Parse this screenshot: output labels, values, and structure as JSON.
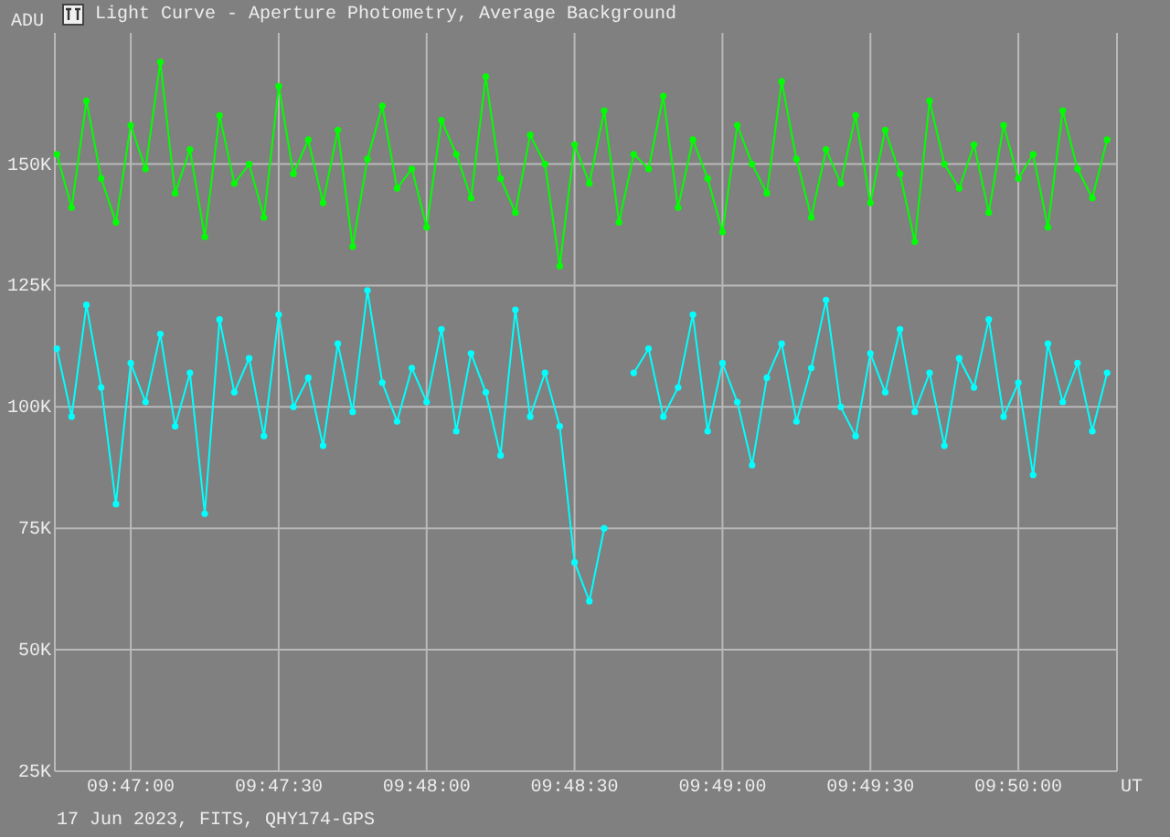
{
  "window": {
    "title": "Light Curve - Aperture Photometry, Average Background"
  },
  "chart": {
    "chart_data": {
      "type": "line",
      "grid": true,
      "xlabel": "UT",
      "ylabel": "ADU",
      "categories": [
        null,
        null,
        null,
        null,
        null,
        "09:47:00",
        null,
        null,
        null,
        null,
        null,
        null,
        null,
        null,
        null,
        "09:47:30",
        null,
        null,
        null,
        null,
        null,
        null,
        null,
        null,
        null,
        "09:48:00",
        null,
        null,
        null,
        null,
        null,
        null,
        null,
        null,
        null,
        "09:48:30",
        null,
        null,
        null,
        null,
        null,
        null,
        null,
        null,
        null,
        "09:49:00",
        null,
        null,
        null,
        null,
        null,
        null,
        null,
        null,
        null,
        "09:49:30",
        null,
        null,
        null,
        null,
        null,
        null,
        null,
        null,
        null,
        "09:50:00",
        null,
        null,
        null,
        null,
        null,
        null
      ],
      "series": [
        {
          "color": "#00ff00",
          "marker": "circle",
          "values": [
            152000,
            141000,
            163000,
            147000,
            138000,
            158000,
            149000,
            171000,
            144000,
            153000,
            135000,
            160000,
            146000,
            150000,
            139000,
            166000,
            148000,
            155000,
            142000,
            157000,
            133000,
            151000,
            162000,
            145000,
            149000,
            137000,
            159000,
            152000,
            143000,
            168000,
            147000,
            140000,
            156000,
            150000,
            129000,
            154000,
            146000,
            161000,
            138000,
            152000,
            149000,
            164000,
            141000,
            155000,
            147000,
            136000,
            158000,
            150000,
            144000,
            167000,
            151000,
            139000,
            153000,
            146000,
            160000,
            142000,
            157000,
            148000,
            134000,
            163000,
            150000,
            145000,
            154000,
            140000,
            158000,
            147000,
            152000,
            137000,
            161000,
            149000,
            143000,
            155000
          ]
        },
        {
          "color": "#00ffff",
          "marker": "circle",
          "values": [
            112000,
            98000,
            121000,
            104000,
            80000,
            109000,
            101000,
            115000,
            96000,
            107000,
            78000,
            118000,
            103000,
            110000,
            94000,
            119000,
            100000,
            106000,
            92000,
            113000,
            99000,
            124000,
            105000,
            97000,
            108000,
            101000,
            116000,
            95000,
            111000,
            103000,
            90000,
            120000,
            98000,
            107000,
            96000,
            68000,
            60000,
            75000,
            null,
            107000,
            112000,
            98000,
            104000,
            119000,
            95000,
            109000,
            101000,
            88000,
            106000,
            113000,
            97000,
            108000,
            122000,
            100000,
            94000,
            111000,
            103000,
            116000,
            99000,
            107000,
            92000,
            110000,
            104000,
            118000,
            98000,
            105000,
            86000,
            113000,
            101000,
            109000,
            95000,
            107000
          ]
        }
      ],
      "ylim": [
        25000,
        177000
      ],
      "yticks": [
        {
          "value": 25000,
          "label": "25K"
        },
        {
          "value": 50000,
          "label": "50K"
        },
        {
          "value": 75000,
          "label": "75K"
        },
        {
          "value": 100000,
          "label": "100K"
        },
        {
          "value": 125000,
          "label": "125K"
        },
        {
          "value": 150000,
          "label": "150K"
        }
      ]
    }
  },
  "footer": "17 Jun 2023, FITS, QHY174-GPS"
}
